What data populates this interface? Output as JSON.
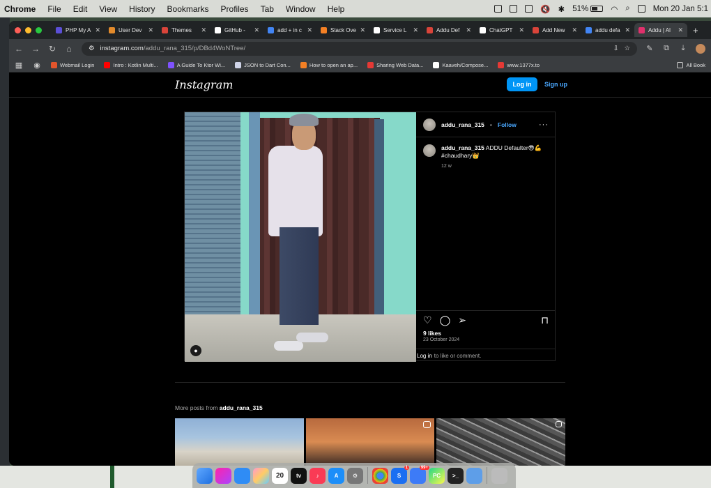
{
  "menubar": {
    "app": "Chrome",
    "items": [
      "File",
      "Edit",
      "View",
      "History",
      "Bookmarks",
      "Profiles",
      "Tab",
      "Window",
      "Help"
    ],
    "battery": "51%",
    "datetime": "Mon 20 Jan 5:1"
  },
  "tabs": [
    {
      "label": "PHP My A",
      "color": "#5b4fd6"
    },
    {
      "label": "User Dev",
      "color": "#e28a2b"
    },
    {
      "label": "Themes",
      "color": "#d9443a"
    },
    {
      "label": "GitHub -",
      "color": "#ffffff"
    },
    {
      "label": "add + in c",
      "color": "#4285f4"
    },
    {
      "label": "Stack Ove",
      "color": "#f48024"
    },
    {
      "label": "Service L",
      "color": "#ffffff"
    },
    {
      "label": "Addu Def",
      "color": "#d9443a"
    },
    {
      "label": "ChatGPT",
      "color": "#ffffff"
    },
    {
      "label": "Add New",
      "color": "#d9443a"
    },
    {
      "label": "addu defa",
      "color": "#4285f4"
    },
    {
      "label": "Addu | Al",
      "color": "#e1306c",
      "active": true
    }
  ],
  "omnibox": {
    "host": "instagram.com",
    "path": "/addu_rana_315/p/DBd4WoNTree/"
  },
  "bookmarks": [
    {
      "label": "Webmail Login",
      "color": "#e3552c"
    },
    {
      "label": "Intro : Kotlin Multi...",
      "color": "#ff0000"
    },
    {
      "label": "A Guide To Ktor Wi...",
      "color": "#7f52ff"
    },
    {
      "label": "JSON to Dart Con...",
      "color": "#cfd4e8"
    },
    {
      "label": "How to open an ap...",
      "color": "#f48024"
    },
    {
      "label": "Sharing Web Data...",
      "color": "#e53935"
    },
    {
      "label": "Kaaveh/Compose...",
      "color": "#ffffff"
    },
    {
      "label": "www.1377x.to",
      "color": "#e53935"
    }
  ],
  "bookmarks_right": "All Book",
  "instagram": {
    "logo": "Instagram",
    "login": "Log in",
    "signup": "Sign up",
    "post": {
      "username": "addu_rana_315",
      "follow": "Follow",
      "caption_user": "addu_rana_315",
      "caption_text": " ADDU Defaulter😎💪#chaudhary👑",
      "caption_time": "12 w",
      "likes": "9 likes",
      "date": "23 October 2024",
      "comment_login": "Log in",
      "comment_rest": "to like or comment."
    },
    "more_label": "More posts from ",
    "more_user": "addu_rana_315"
  },
  "dock": {
    "calendar_day": "20",
    "tv_label": "tv",
    "badge_slack": "1",
    "badge_chrome": "99+"
  }
}
